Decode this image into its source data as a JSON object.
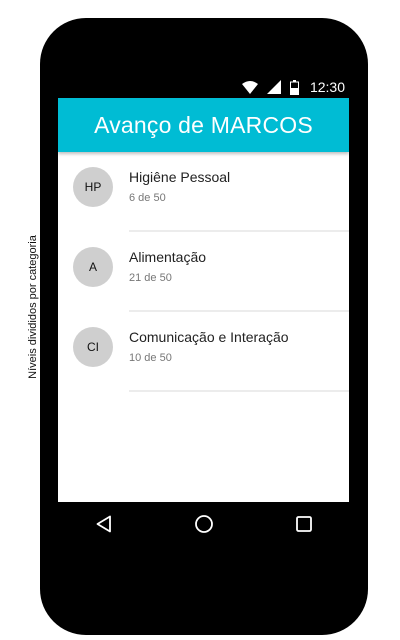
{
  "side_caption": "Níveis divididos por categoria",
  "status_bar": {
    "time": "12:30",
    "icons": [
      "wifi-icon",
      "signal-icon",
      "battery-icon"
    ]
  },
  "app_bar": {
    "title": "Avanço de MARCOS",
    "color": "#00bcd4"
  },
  "list": {
    "items": [
      {
        "avatar": "HP",
        "title": "Higiêne Pessoal",
        "subtitle": "6 de 50"
      },
      {
        "avatar": "A",
        "title": "Alimentação",
        "subtitle": "21 de 50"
      },
      {
        "avatar": "CI",
        "title": "Comunicação e Interação",
        "subtitle": "10 de 50"
      }
    ]
  },
  "nav_bar": {
    "icons": [
      "back-icon",
      "home-icon",
      "recent-apps-icon"
    ]
  }
}
